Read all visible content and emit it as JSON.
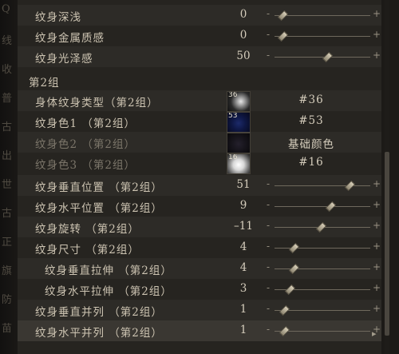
{
  "left_strip_glyphs": [
    "Q",
    "线",
    "收",
    "普",
    "古",
    "出",
    "世",
    "古",
    "正",
    "旗",
    "防",
    "苗"
  ],
  "rows_top": [
    {
      "label": "纹身深浅",
      "value": "0",
      "slider": 0.08
    },
    {
      "label": "纹身金属质感",
      "value": "0",
      "slider": 0.08
    },
    {
      "label": "纹身光泽感",
      "value": "50",
      "slider": 0.55
    }
  ],
  "section_title": "第2组",
  "option_rows": [
    {
      "label": "身体纹身类型（第2组）",
      "thumb_num": "36",
      "thumb_style": "scratch",
      "value": "#36",
      "dim": false
    },
    {
      "label": "纹身色1 （第2组）",
      "thumb_num": "53",
      "thumb_style": "navy",
      "value": "#53",
      "dim": false
    },
    {
      "label": "纹身色2 （第2组）",
      "thumb_num": "",
      "thumb_style": "dark",
      "value": "基础颜色",
      "dim": true
    },
    {
      "label": "纹身色3 （第2组）",
      "thumb_num": "16",
      "thumb_style": "white",
      "value": "#16",
      "dim": true
    }
  ],
  "rows_bottom": [
    {
      "label": "纹身垂直位置 （第2组）",
      "value": "51",
      "slider": 0.78,
      "indent": false
    },
    {
      "label": "纹身水平位置 （第2组）",
      "value": "9",
      "slider": 0.58,
      "indent": false
    },
    {
      "label": "纹身旋转 （第2组）",
      "value": "–11",
      "slider": 0.48,
      "indent": false
    },
    {
      "label": "纹身尺寸 （第2组）",
      "value": "4",
      "slider": 0.2,
      "indent": false
    },
    {
      "label": "纹身垂直拉伸 （第2组）",
      "value": "4",
      "slider": 0.2,
      "indent": true
    },
    {
      "label": "纹身水平拉伸 （第2组）",
      "value": "3",
      "slider": 0.16,
      "indent": true
    },
    {
      "label": "纹身垂直并列 （第2组）",
      "value": "1",
      "slider": 0.1,
      "indent": false
    },
    {
      "label": "纹身水平并列 （第2组）",
      "value": "1",
      "slider": 0.1,
      "indent": false
    }
  ],
  "slider_minus": "-",
  "slider_plus": "+",
  "cursor_arrow": "▸"
}
